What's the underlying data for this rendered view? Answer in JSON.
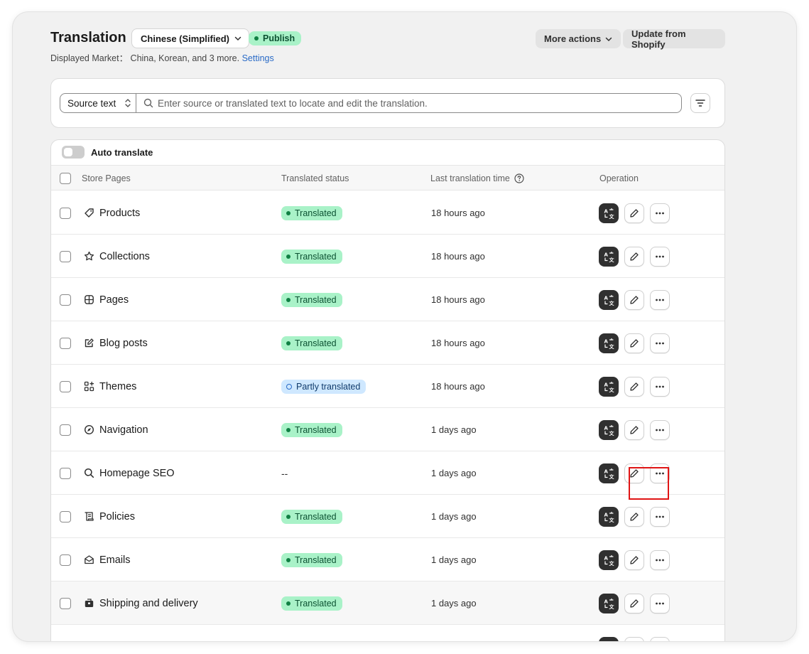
{
  "header": {
    "title": "Translation",
    "language": "Chinese (Simplified)",
    "publish_status": "Publish",
    "market_label": "Displayed Market： China, Korean, and 3 more.",
    "settings_link": "Settings",
    "more_actions": "More actions",
    "update_button": "Update from Shopify"
  },
  "search": {
    "source_select": "Source text",
    "placeholder": "Enter source or translated text to locate and edit the translation."
  },
  "table": {
    "auto_translate": "Auto translate",
    "columns": {
      "pages": "Store Pages",
      "status": "Translated status",
      "time": "Last translation time",
      "operation": "Operation"
    },
    "rows": [
      {
        "name": "Products",
        "icon": "tag-icon",
        "status": "Translated",
        "time": "18 hours ago"
      },
      {
        "name": "Collections",
        "icon": "star-icon",
        "status": "Translated",
        "time": "18 hours ago"
      },
      {
        "name": "Pages",
        "icon": "pages-icon",
        "status": "Translated",
        "time": "18 hours ago"
      },
      {
        "name": "Blog posts",
        "icon": "edit-square-icon",
        "status": "Translated",
        "time": "18 hours ago"
      },
      {
        "name": "Themes",
        "icon": "apps-icon",
        "status": "Partly translated",
        "time": "18 hours ago"
      },
      {
        "name": "Navigation",
        "icon": "compass-icon",
        "status": "Translated",
        "time": "1 days ago"
      },
      {
        "name": "Homepage SEO",
        "icon": "search-icon",
        "status": "--",
        "time": "1 days ago"
      },
      {
        "name": "Policies",
        "icon": "policy-icon",
        "status": "Translated",
        "time": "1 days ago"
      },
      {
        "name": "Emails",
        "icon": "email-icon",
        "status": "Translated",
        "time": "1 days ago"
      },
      {
        "name": "Shipping and delivery",
        "icon": "delivery-icon",
        "status": "Translated",
        "time": "1 days ago"
      }
    ]
  },
  "colors": {
    "accent_link": "#2a6bc7",
    "badge_success_bg": "#a9f2c8",
    "badge_info_bg": "#cfe8ff",
    "highlight_box": "#e01515"
  }
}
